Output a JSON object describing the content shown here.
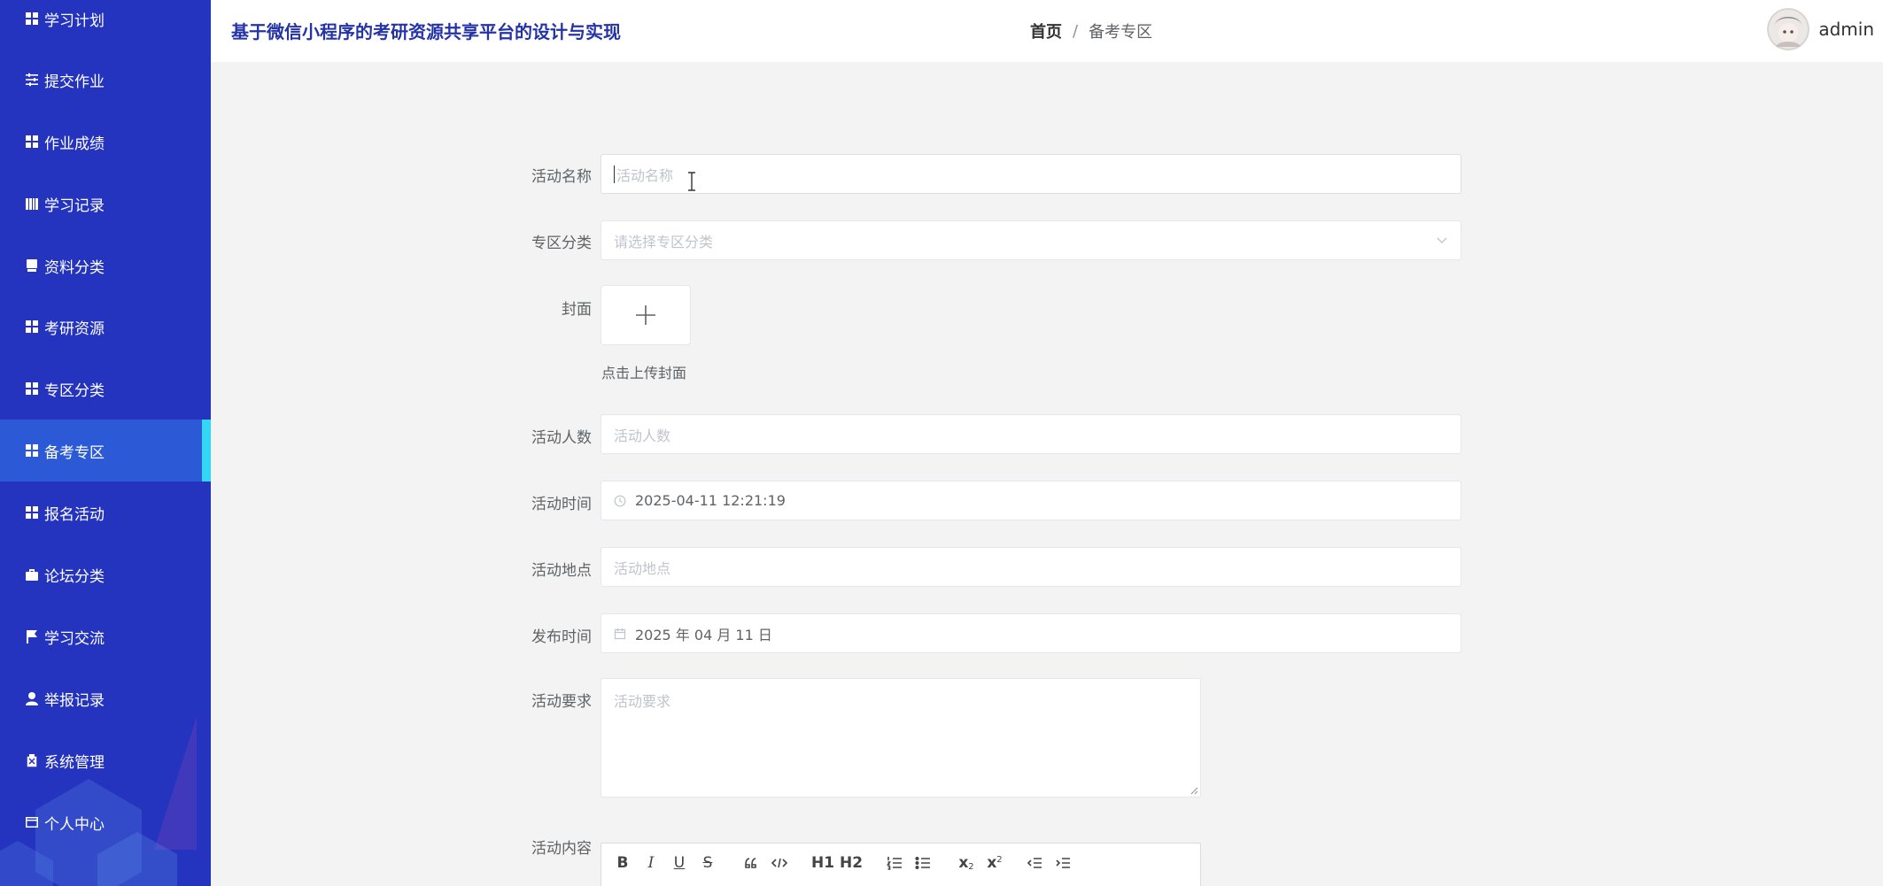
{
  "sidebar": {
    "items": [
      {
        "label": "学习计划",
        "icon": "grid-icon"
      },
      {
        "label": "提交作业",
        "icon": "sliders-icon"
      },
      {
        "label": "作业成绩",
        "icon": "grid-icon"
      },
      {
        "label": "学习记录",
        "icon": "books-icon"
      },
      {
        "label": "资料分类",
        "icon": "monitor-icon"
      },
      {
        "label": "考研资源",
        "icon": "grid-icon"
      },
      {
        "label": "专区分类",
        "icon": "grid-icon"
      },
      {
        "label": "备考专区",
        "icon": "grid-icon"
      },
      {
        "label": "报名活动",
        "icon": "grid-icon"
      },
      {
        "label": "论坛分类",
        "icon": "briefcase-icon"
      },
      {
        "label": "学习交流",
        "icon": "flag-icon"
      },
      {
        "label": "举报记录",
        "icon": "user-icon"
      },
      {
        "label": "系统管理",
        "icon": "clipboard-icon"
      },
      {
        "label": "个人中心",
        "icon": "card-icon"
      }
    ],
    "active_index": 7,
    "colors": {
      "bg": "#2434bf",
      "active_bg": "#2c5ad6",
      "active_bar": "#34d6f5"
    }
  },
  "header": {
    "title": "基于微信小程序的考研资源共享平台的设计与实现",
    "breadcrumb": {
      "home": "首页",
      "separator": "/",
      "current": "备考专区"
    },
    "username": "admin"
  },
  "form": {
    "name": {
      "label": "活动名称",
      "placeholder": "活动名称"
    },
    "category": {
      "label": "专区分类",
      "placeholder": "请选择专区分类"
    },
    "cover": {
      "label": "封面",
      "tip": "点击上传封面"
    },
    "people": {
      "label": "活动人数",
      "placeholder": "活动人数"
    },
    "time": {
      "label": "活动时间",
      "value": "2025-04-11 12:21:19"
    },
    "location": {
      "label": "活动地点",
      "placeholder": "活动地点"
    },
    "publish": {
      "label": "发布时间",
      "value": "2025 年 04 月 11 日"
    },
    "requirement": {
      "label": "活动要求",
      "placeholder": "活动要求"
    },
    "content": {
      "label": "活动内容"
    }
  },
  "editor_toolbar": [
    "B",
    "I",
    "U",
    "S",
    "quote",
    "code",
    "H1",
    "H2",
    "ordered-list",
    "bullet-list",
    "subscript",
    "superscript",
    "outdent",
    "indent"
  ]
}
